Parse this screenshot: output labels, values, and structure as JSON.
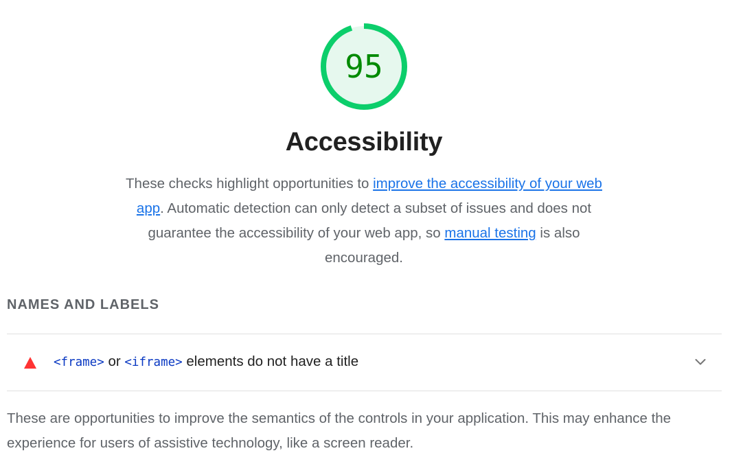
{
  "category": {
    "score": "95",
    "score_fraction": 0.95,
    "score_color": "#0cce6b",
    "score_text_color": "#008a00",
    "title": "Accessibility",
    "description": {
      "part1": "These checks highlight opportunities to ",
      "link1": "improve the accessibility of your web app",
      "part2": ". Automatic detection can only detect a subset of issues and does not guarantee the accessibility of your web app, so ",
      "link2": "manual testing",
      "part3": " is also encouraged."
    }
  },
  "group": {
    "title": "NAMES AND LABELS",
    "audits": [
      {
        "status": "fail",
        "status_icon": "warning-triangle-icon",
        "code1": "<frame>",
        "text1": " or ",
        "code2": "<iframe>",
        "text2": " elements do not have a title",
        "expand_icon": "chevron-down-icon"
      }
    ],
    "description": "These are opportunities to improve the semantics of the controls in your application. This may enhance the experience for users of assistive technology, like a screen reader."
  }
}
